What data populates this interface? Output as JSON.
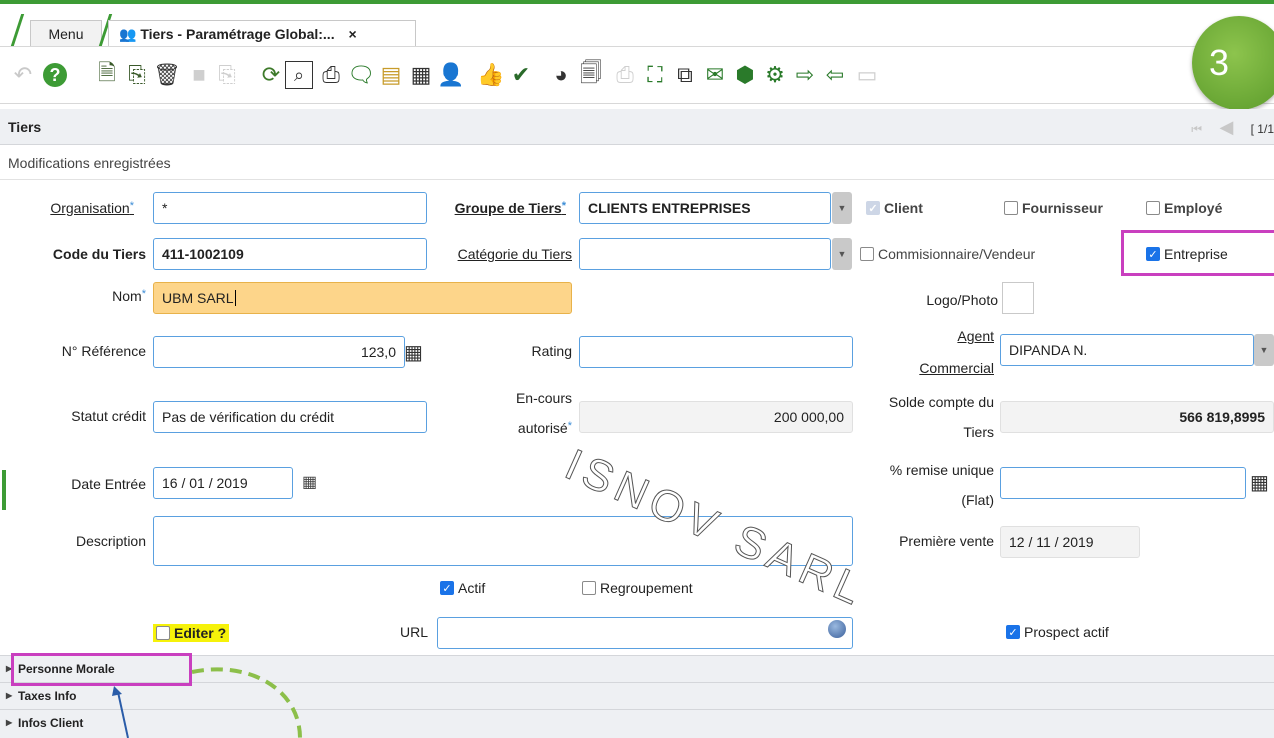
{
  "tabs": {
    "menu": "Menu",
    "active": "Tiers - Paramétrage Global:...",
    "close": "×"
  },
  "badge": "3",
  "header": {
    "title": "Tiers",
    "pager": "[ 1/1"
  },
  "status_message": "Modifications enregistrées",
  "form": {
    "organisation": {
      "label": "Organisation",
      "value": "*"
    },
    "groupe": {
      "label": "Groupe de Tiers",
      "value": "CLIENTS ENTREPRISES"
    },
    "client": "Client",
    "fournisseur": "Fournisseur",
    "employe": "Employé",
    "code": {
      "label": "Code du Tiers",
      "value": "411-1002109"
    },
    "categorie": {
      "label": "Catégorie du Tiers",
      "value": ""
    },
    "commissionnaire": "Commisionnaire/Vendeur",
    "entreprise": "Entreprise",
    "nom": {
      "label": "Nom",
      "value": "UBM SARL"
    },
    "logo": "Logo/Photo",
    "reference": {
      "label": "N° Référence",
      "value": "123,0"
    },
    "rating": {
      "label": "Rating",
      "value": ""
    },
    "agent": {
      "label_1": "Agent",
      "label_2": "Commercial",
      "value": "DIPANDA N."
    },
    "statut": {
      "label": "Statut crédit",
      "value": "Pas de vérification du crédit"
    },
    "encours": {
      "label_1": "En-cours",
      "label_2": "autorisé",
      "value": "200 000,00"
    },
    "solde": {
      "label_1": "Solde compte du",
      "label_2": "Tiers",
      "value": "566 819,8995"
    },
    "date_entree": {
      "label": "Date Entrée",
      "value": "16 / 01 / 2019"
    },
    "remise": {
      "label_1": "% remise unique",
      "label_2": "(Flat)",
      "value": ""
    },
    "description": {
      "label": "Description",
      "value": ""
    },
    "premiere_vente": {
      "label": "Première vente",
      "value": "12 / 11 / 2019"
    },
    "actif": "Actif",
    "regroupement": "Regroupement",
    "editer": "Editer ?",
    "url": {
      "label": "URL",
      "value": ""
    },
    "prospect": "Prospect actif"
  },
  "sections": [
    "Personne Morale",
    "Taxes Info",
    "Infos Client"
  ],
  "watermark": "ISNOV SARL"
}
